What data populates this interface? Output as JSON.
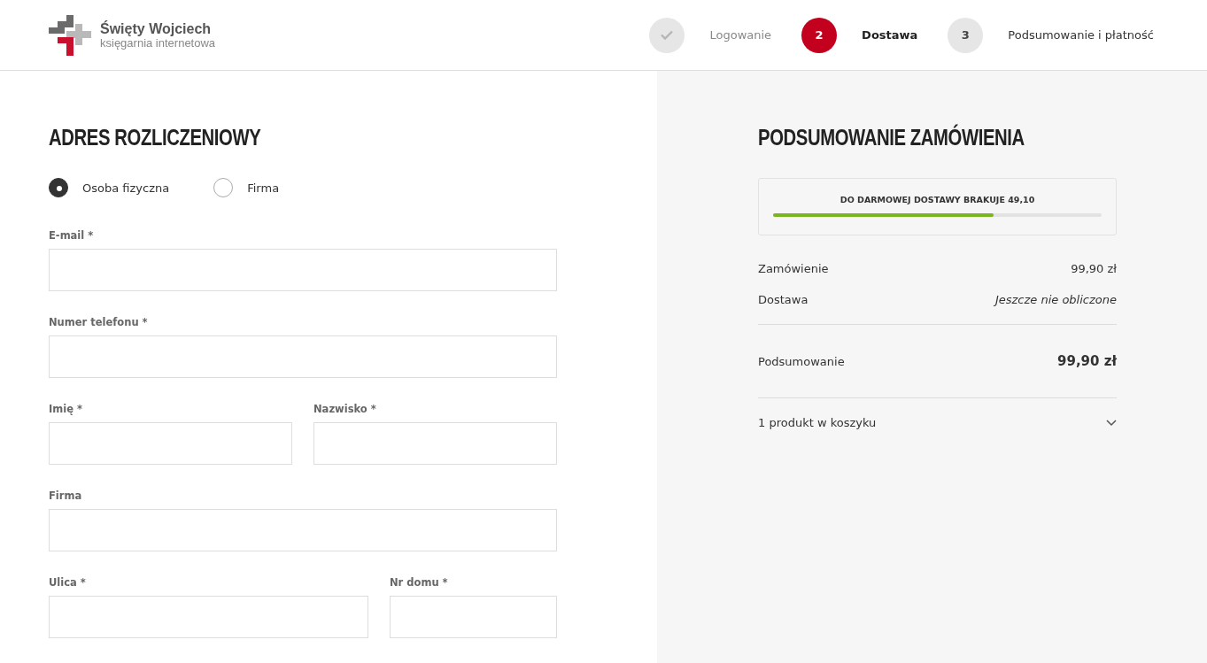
{
  "logo": {
    "name": "Święty Wojciech",
    "tagline": "księgarnia internetowa"
  },
  "steps": [
    {
      "label": "Logowanie",
      "kind": "done"
    },
    {
      "number": "2",
      "label": "Dostawa",
      "kind": "active"
    },
    {
      "number": "3",
      "label": "Podsumowanie i płatność",
      "kind": "pending"
    }
  ],
  "billing": {
    "title": "ADRES ROZLICZENIOWY",
    "customer_type": [
      {
        "label": "Osoba fizyczna",
        "selected": true
      },
      {
        "label": "Firma",
        "selected": false
      }
    ],
    "rows": [
      {
        "kind": "full",
        "fields": [
          {
            "label": "E-mail *"
          }
        ]
      },
      {
        "kind": "full",
        "fields": [
          {
            "label": "Numer telefonu *"
          }
        ]
      },
      {
        "kind": "half",
        "fields": [
          {
            "label": "Imię *"
          },
          {
            "label": "Nazwisko *"
          }
        ]
      },
      {
        "kind": "full",
        "fields": [
          {
            "label": "Firma"
          }
        ]
      },
      {
        "kind": "street",
        "fields": [
          {
            "label": "Ulica *"
          },
          {
            "label": "Nr domu *"
          }
        ]
      }
    ]
  },
  "summary": {
    "title": "PODSUMOWANIE ZAMÓWIENIA",
    "free_shipping": {
      "text": "DO DARMOWEJ DOSTAWY BRAKUJE 49,10",
      "level": 0.67
    },
    "lines": [
      {
        "label": "Zamówienie",
        "value": "99,90 zł",
        "kind": "normal"
      },
      {
        "label": "Dostawa",
        "value": "Jeszcze nie obliczone",
        "kind": "pending"
      }
    ],
    "total": {
      "label": "Podsumowanie",
      "value": "99,90 zł"
    },
    "cart": {
      "label": "1 produkt w koszyku",
      "expanded": false
    }
  }
}
